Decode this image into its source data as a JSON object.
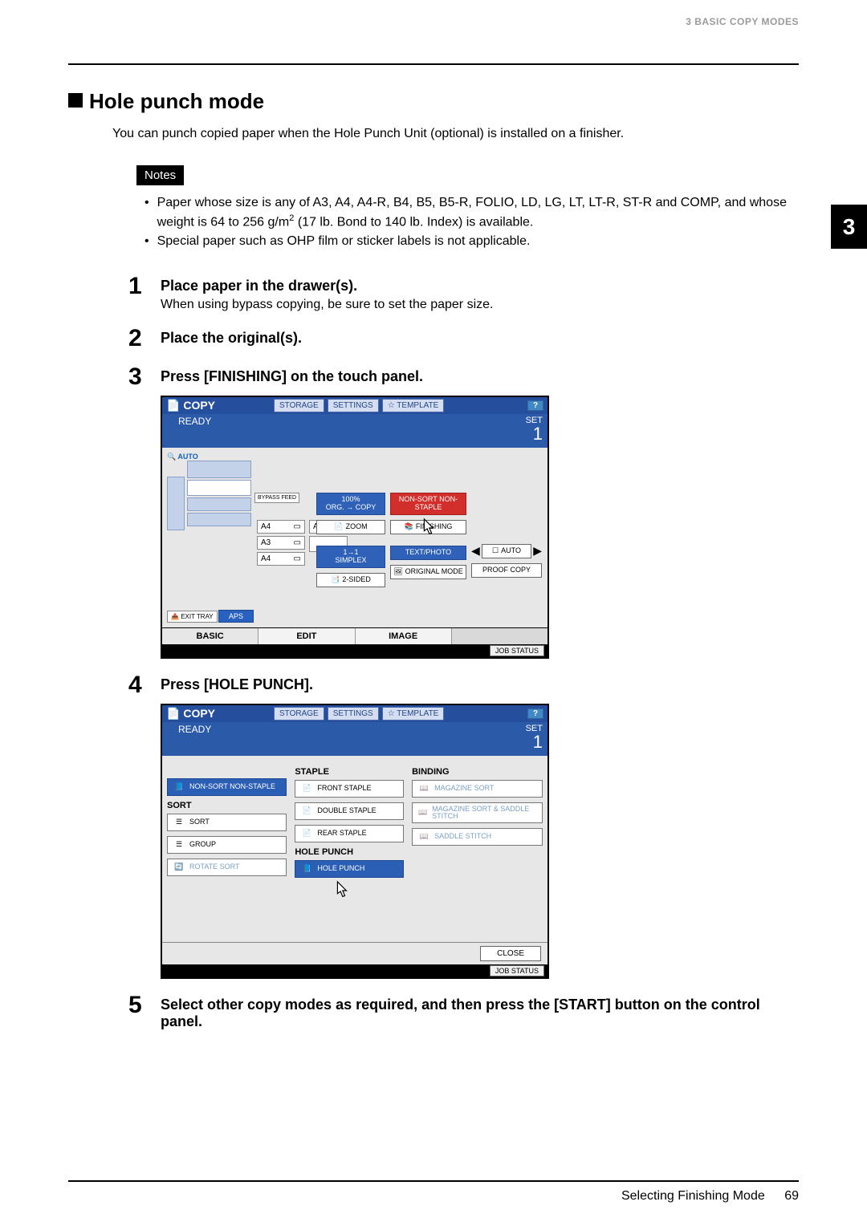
{
  "header": "3 BASIC COPY MODES",
  "tab_number": "3",
  "section_title": "Hole punch mode",
  "intro": "You can punch copied paper when the Hole Punch Unit (optional) is installed on a finisher.",
  "notes_label": "Notes",
  "notes": [
    "Paper whose size is any of A3, A4, A4-R, B4, B5, B5-R, FOLIO, LD, LG, LT, LT-R, ST-R and COMP, and whose weight is 64 to 256 g/m2 (17 lb. Bond to 140 lb. Index) is available.",
    "Special paper such as OHP film or sticker labels is not applicable."
  ],
  "steps": {
    "s1_title": "Place paper in the drawer(s).",
    "s1_sub": "When using bypass copying, be sure to set the paper size.",
    "s2_title": "Place the original(s).",
    "s3_title": "Press [FINISHING] on the touch panel.",
    "s4_title": "Press [HOLE PUNCH].",
    "s5_title": "Select other copy modes as required, and then press the [START] button on the control panel."
  },
  "panel_common": {
    "title": "COPY",
    "storage": "STORAGE",
    "settings": "SETTINGS",
    "template": "TEMPLATE",
    "help": "?",
    "ready": "READY",
    "set_label": "SET",
    "set_value": "1",
    "job_status": "JOB STATUS"
  },
  "panel1": {
    "auto": "AUTO",
    "bypass": "BYPASS FEED",
    "drawers": [
      "A4",
      "A3",
      "A4"
    ],
    "extra_drawer": "A4",
    "exit_tray": "EXIT TRAY",
    "aps": "APS",
    "zoom_pct": "100%",
    "zoom_dir": "ORG. → COPY",
    "zoom": "ZOOM",
    "simplex_top": "1→1",
    "simplex": "SIMPLEX",
    "two_sided": "2-SIDED",
    "non_sort": "NON-SORT NON-STAPLE",
    "finishing": "FINISHING",
    "text_photo": "TEXT/PHOTO",
    "original_mode": "ORIGINAL MODE",
    "auto_btn": "AUTO",
    "proof_copy": "PROOF COPY",
    "tabs": {
      "basic": "BASIC",
      "edit": "EDIT",
      "image": "IMAGE"
    }
  },
  "panel2": {
    "left_active": "NON-SORT NON-STAPLE",
    "sort_hdr": "SORT",
    "sort": "SORT",
    "group": "GROUP",
    "rotate_sort": "ROTATE SORT",
    "staple_hdr": "STAPLE",
    "front_staple": "FRONT STAPLE",
    "double_staple": "DOUBLE STAPLE",
    "rear_staple": "REAR STAPLE",
    "hole_punch_hdr": "HOLE PUNCH",
    "hole_punch": "HOLE PUNCH",
    "binding_hdr": "BINDING",
    "mag_sort": "MAGAZINE SORT",
    "mag_sort_saddle": "MAGAZINE SORT & SADDLE STITCH",
    "saddle": "SADDLE STITCH",
    "close": "CLOSE"
  },
  "footer": {
    "section": "Selecting Finishing Mode",
    "page": "69"
  }
}
